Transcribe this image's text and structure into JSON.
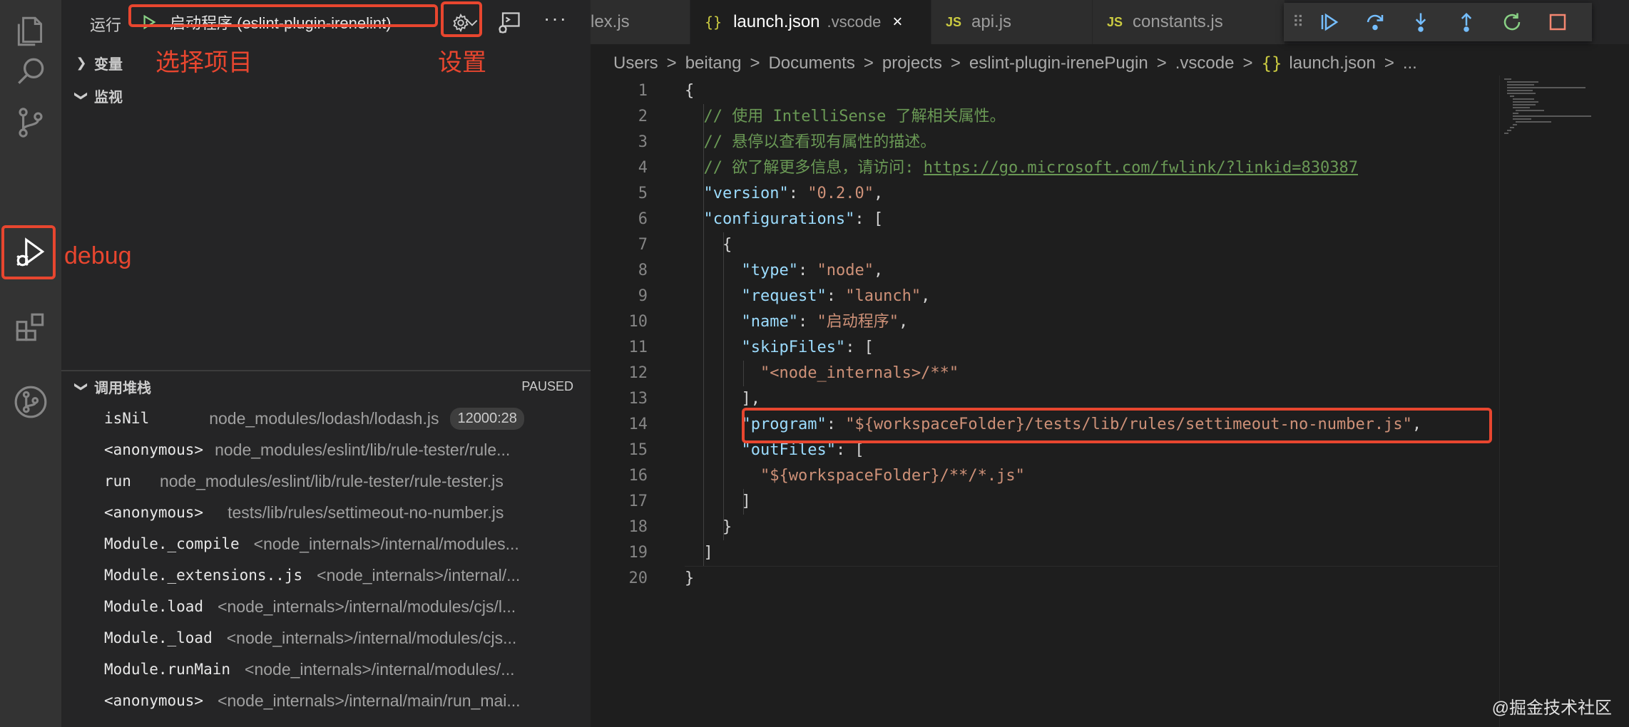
{
  "activity_bar": {
    "icons": [
      "explorer-icon",
      "search-icon",
      "source-control-icon",
      "run-debug-icon",
      "extensions-icon",
      "git-graph-icon"
    ]
  },
  "run_bar": {
    "label": "运行",
    "config": "启动程序 (eslint-plugin-irenelint)",
    "more": "···"
  },
  "sections": {
    "variables": "变量",
    "watch": "监视",
    "call_stack": "调用堆栈",
    "paused": "PAUSED"
  },
  "call_stack": [
    {
      "fn": "isNil",
      "file": "node_modules/lodash/lodash.js",
      "line": "12000:28"
    },
    {
      "fn": "<anonymous>",
      "file": "node_modules/eslint/lib/rule-tester/rule..."
    },
    {
      "fn": "run",
      "file": "node_modules/eslint/lib/rule-tester/rule-tester.js"
    },
    {
      "fn": "<anonymous>",
      "file": "tests/lib/rules/settimeout-no-number.js"
    },
    {
      "fn": "Module._compile",
      "file": "<node_internals>/internal/modules..."
    },
    {
      "fn": "Module._extensions..js",
      "file": "<node_internals>/internal/..."
    },
    {
      "fn": "Module.load",
      "file": "<node_internals>/internal/modules/cjs/l..."
    },
    {
      "fn": "Module._load",
      "file": "<node_internals>/internal/modules/cjs..."
    },
    {
      "fn": "Module.runMain",
      "file": "<node_internals>/internal/modules/..."
    },
    {
      "fn": "<anonymous>",
      "file": "<node_internals>/internal/main/run_mai..."
    }
  ],
  "tabs": [
    {
      "name": "lex.js"
    },
    {
      "name": "launch.json",
      "sub": ".vscode",
      "close": "×"
    },
    {
      "name": "api.js",
      "type": "JS"
    },
    {
      "name": "constants.js",
      "type": "JS"
    }
  ],
  "tab_icons": {
    "json": "{}"
  },
  "breadcrumb": [
    "Users",
    "beitang",
    "Documents",
    "projects",
    "eslint-plugin-irenePugin",
    ".vscode",
    "launch.json",
    "..."
  ],
  "breadcrumb_sep": ">",
  "code_lines": [
    {
      "n": "1",
      "parts": [
        [
          "p",
          "{"
        ]
      ]
    },
    {
      "n": "2",
      "parts": [
        [
          "p",
          "  "
        ],
        [
          "c",
          "// 使用 IntelliSense 了解相关属性。"
        ]
      ]
    },
    {
      "n": "3",
      "parts": [
        [
          "p",
          "  "
        ],
        [
          "c",
          "// 悬停以查看现有属性的描述。"
        ]
      ]
    },
    {
      "n": "4",
      "parts": [
        [
          "p",
          "  "
        ],
        [
          "c",
          "// 欲了解更多信息，请访问: "
        ],
        [
          "l",
          "https://go.microsoft.com/fwlink/?linkid=830387"
        ]
      ]
    },
    {
      "n": "5",
      "parts": [
        [
          "p",
          "  "
        ],
        [
          "k",
          "\"version\""
        ],
        [
          "p",
          ": "
        ],
        [
          "s",
          "\"0.2.0\""
        ],
        [
          "p",
          ","
        ]
      ]
    },
    {
      "n": "6",
      "parts": [
        [
          "p",
          "  "
        ],
        [
          "k",
          "\"configurations\""
        ],
        [
          "p",
          ": ["
        ]
      ]
    },
    {
      "n": "7",
      "parts": [
        [
          "p",
          "    {"
        ]
      ]
    },
    {
      "n": "8",
      "parts": [
        [
          "p",
          "      "
        ],
        [
          "k",
          "\"type\""
        ],
        [
          "p",
          ": "
        ],
        [
          "s",
          "\"node\""
        ],
        [
          "p",
          ","
        ]
      ]
    },
    {
      "n": "9",
      "parts": [
        [
          "p",
          "      "
        ],
        [
          "k",
          "\"request\""
        ],
        [
          "p",
          ": "
        ],
        [
          "s",
          "\"launch\""
        ],
        [
          "p",
          ","
        ]
      ]
    },
    {
      "n": "10",
      "parts": [
        [
          "p",
          "      "
        ],
        [
          "k",
          "\"name\""
        ],
        [
          "p",
          ": "
        ],
        [
          "s",
          "\"启动程序\""
        ],
        [
          "p",
          ","
        ]
      ]
    },
    {
      "n": "11",
      "parts": [
        [
          "p",
          "      "
        ],
        [
          "k",
          "\"skipFiles\""
        ],
        [
          "p",
          ": ["
        ]
      ]
    },
    {
      "n": "12",
      "parts": [
        [
          "p",
          "        "
        ],
        [
          "s",
          "\"<node_internals>/**\""
        ]
      ]
    },
    {
      "n": "13",
      "parts": [
        [
          "p",
          "      ],"
        ]
      ]
    },
    {
      "n": "14",
      "parts": [
        [
          "p",
          "      "
        ],
        [
          "k",
          "\"program\""
        ],
        [
          "p",
          ": "
        ],
        [
          "s",
          "\"${workspaceFolder}/tests/lib/rules/settimeout-no-number.js\""
        ],
        [
          "p",
          ","
        ]
      ]
    },
    {
      "n": "15",
      "parts": [
        [
          "p",
          "      "
        ],
        [
          "k",
          "\"outFiles\""
        ],
        [
          "p",
          ": ["
        ]
      ]
    },
    {
      "n": "16",
      "parts": [
        [
          "p",
          "        "
        ],
        [
          "s",
          "\"${workspaceFolder}/**/*.js\""
        ]
      ]
    },
    {
      "n": "17",
      "parts": [
        [
          "p",
          "      ]"
        ]
      ]
    },
    {
      "n": "18",
      "parts": [
        [
          "p",
          "    }"
        ]
      ]
    },
    {
      "n": "19",
      "parts": [
        [
          "p",
          "  ]"
        ]
      ]
    },
    {
      "n": "20",
      "parts": [
        [
          "p",
          "}"
        ]
      ]
    }
  ],
  "annotations": {
    "select_project": "选择项目",
    "settings": "设置",
    "debug": "debug"
  },
  "watermark": "@掘金技术社区",
  "colors": {
    "accent_red": "#e8462f",
    "play_green": "#89d185",
    "debug_blue": "#75beff"
  }
}
